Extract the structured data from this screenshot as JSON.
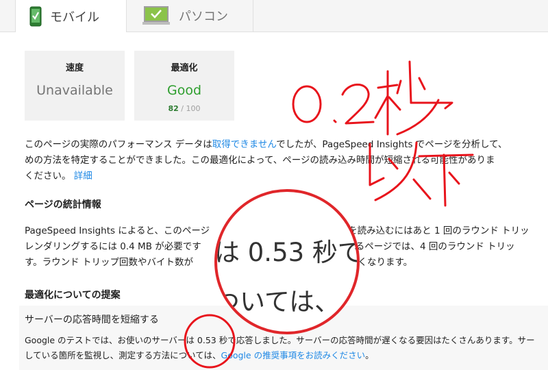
{
  "tabs": [
    {
      "label": "モバイル",
      "icon": "mobile-phone-check-icon",
      "active": true
    },
    {
      "label": "パソコン",
      "icon": "desktop-monitor-check-icon",
      "active": false
    }
  ],
  "cards": {
    "speed": {
      "heading": "速度",
      "value": "Unavailable"
    },
    "optimization": {
      "heading": "最適化",
      "value": "Good",
      "score": "82",
      "score_max": "/ 100"
    }
  },
  "intro": {
    "line1_a": "このページの実際のパフォーマンス データは",
    "line1_link": "取得できません",
    "line1_b": "でしたが、PageSpeed Insights でページを分析して、",
    "line2": "めの方法を特定することができました。この最適化によって、ページの読み込み時間が短縮される可能性がありま",
    "line3_a": "ください。",
    "line3_link": "詳細"
  },
  "stats": {
    "heading": "ページの統計情報",
    "line1_a": "PageSpeed Insights によると、このページ",
    "line1_b": "を読み込むにはあと 1 回のラウンド トリッ",
    "line2_a": "レンダリングするには 0.4 MB が必要です",
    "line2_b": "当たるページでは、4 回のラウンド トリッ",
    "line3_a": "す。ラウンド トリップ回数やバイト数が",
    "line3_b": "みは速くなります。"
  },
  "suggestions": {
    "heading": "最適化についての提案",
    "title": "サーバーの応答時間を短縮する",
    "line1": "Google のテストでは、お使いのサーバーは 0.53 秒で応答しました。サーバーの応答時間が遅くなる要因はたくさんあります。サー",
    "line2_a": "している箇所を監視し、測定する方法については、",
    "line2_link": "Google の推奨事項をお読みください",
    "line2_b": "。"
  },
  "magnifier": {
    "line1": "は 0.53 秒で",
    "line2": "ついては、"
  },
  "annotation_color": "#e8141c",
  "accent_link": "#1e88e5",
  "good_color": "#2e9e2e"
}
